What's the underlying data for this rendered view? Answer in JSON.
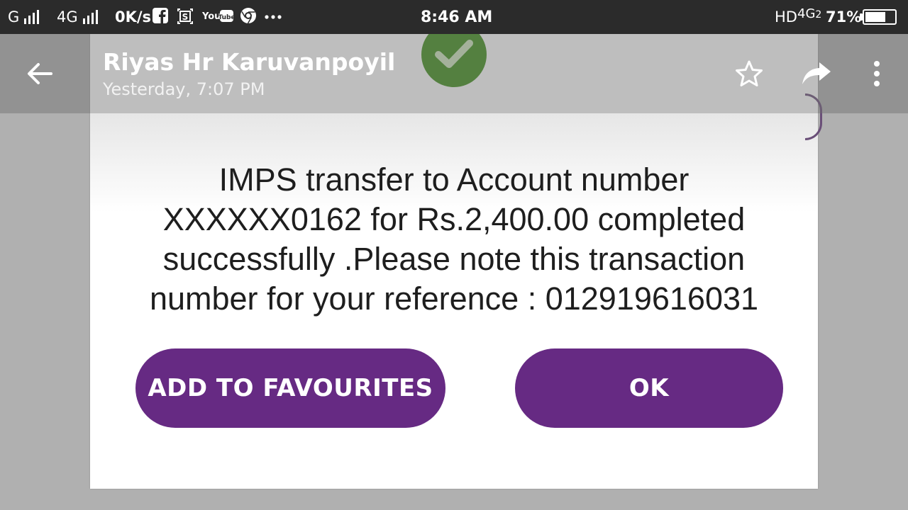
{
  "status_bar": {
    "network1": "G",
    "network2": "4G",
    "speed": "0K/s",
    "youtube": "YouTube",
    "time": "8:46 AM",
    "hd": "HD",
    "network3": "4G",
    "network3_sub": "2",
    "battery": "71%",
    "battery_level": 0.71,
    "icons": [
      "facebook-icon",
      "screenshot-icon",
      "youtube-icon",
      "chrome-icon",
      "more-dots-icon",
      "battery-charging-icon"
    ]
  },
  "header": {
    "back_icon": "arrow-left-icon",
    "sender": "Riyas Hr Karuvanpoyil",
    "timestamp": "Yesterday, 7:07 PM",
    "star_icon": "star-outline-icon",
    "share_icon": "share-forward-icon",
    "more_icon": "more-vertical-icon"
  },
  "dialog": {
    "success_icon": "checkmark-icon",
    "message_lines": [
      "IMPS transfer to Account number",
      "XXXXXX0162 for Rs.2,400.00 completed",
      "successfully .Please note this transaction",
      "number for your reference : 012919616031"
    ],
    "add_to_favourites_label": "ADD TO FAVOURITES",
    "ok_label": "OK"
  },
  "colors": {
    "button": "#662a83",
    "success": "#3f8f1a",
    "statusbar": "#2b2b2b"
  }
}
